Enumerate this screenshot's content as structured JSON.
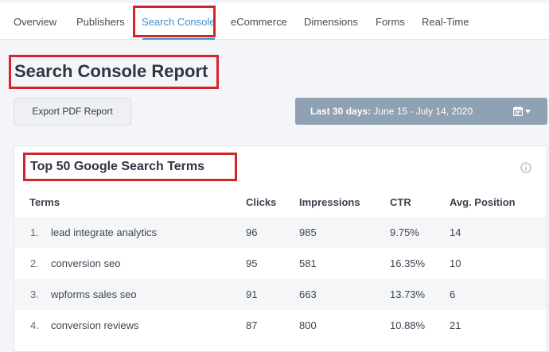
{
  "nav": {
    "tabs": [
      {
        "label": "Overview"
      },
      {
        "label": "Publishers"
      },
      {
        "label": "Search Console"
      },
      {
        "label": "eCommerce"
      },
      {
        "label": "Dimensions"
      },
      {
        "label": "Forms"
      },
      {
        "label": "Real-Time"
      }
    ],
    "active_tab": "Search Console"
  },
  "header": {
    "title": "Search Console Report",
    "export_label": "Export PDF Report",
    "date_range": {
      "prefix": "Last 30 days:",
      "range": " June 15 - July 14, 2020"
    }
  },
  "panel": {
    "title": "Top 50 Google Search Terms",
    "columns": [
      "Terms",
      "Clicks",
      "Impressions",
      "CTR",
      "Avg. Position"
    ],
    "rows": [
      {
        "rank": "1.",
        "term": "lead integrate analytics",
        "clicks": "96",
        "impressions": "985",
        "ctr": "9.75%",
        "position": "14"
      },
      {
        "rank": "2.",
        "term": "conversion seo",
        "clicks": "95",
        "impressions": "581",
        "ctr": "16.35%",
        "position": "10"
      },
      {
        "rank": "3.",
        "term": "wpforms sales seo",
        "clicks": "91",
        "impressions": "663",
        "ctr": "13.73%",
        "position": "6"
      },
      {
        "rank": "4.",
        "term": "conversion reviews",
        "clicks": "87",
        "impressions": "800",
        "ctr": "10.88%",
        "position": "21"
      }
    ]
  },
  "colors": {
    "accent": "#3f90c9",
    "highlight_box": "#d5232b",
    "date_button": "#8fa1b3"
  },
  "icons": {
    "calendar": "calendar-icon",
    "caret": "caret-down-icon",
    "info": "info-icon"
  }
}
